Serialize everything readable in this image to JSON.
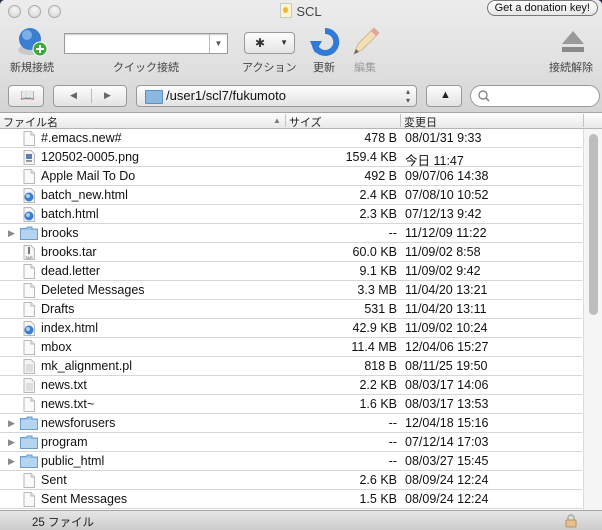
{
  "window": {
    "title": "SCL",
    "donation_button": "Get a donation key!"
  },
  "toolbar": {
    "new_connection": "新規接続",
    "quick_connect": "クイック接続",
    "quick_connect_value": "",
    "action": "アクション",
    "refresh": "更新",
    "edit": "編集",
    "disconnect": "接続解除"
  },
  "navbar": {
    "path": "/user1/scl7/fukumoto",
    "search_placeholder": ""
  },
  "columns": {
    "name": "ファイル名",
    "size": "サイズ",
    "modified": "変更日",
    "sort_indicator": "▲"
  },
  "files": [
    {
      "name": "#.emacs.new#",
      "size": "478 B",
      "date": "08/01/31 9:33",
      "type": "file"
    },
    {
      "name": "120502-0005.png",
      "size": "159.4 KB",
      "date": "今日 11:47",
      "type": "image"
    },
    {
      "name": "Apple Mail To Do",
      "size": "492 B",
      "date": "09/07/06 14:38",
      "type": "file"
    },
    {
      "name": "batch_new.html",
      "size": "2.4 KB",
      "date": "07/08/10 10:52",
      "type": "html"
    },
    {
      "name": "batch.html",
      "size": "2.3 KB",
      "date": "07/12/13 9:42",
      "type": "html"
    },
    {
      "name": "brooks",
      "size": "--",
      "date": "11/12/09 11:22",
      "type": "folder"
    },
    {
      "name": "brooks.tar",
      "size": "60.0 KB",
      "date": "11/09/02 8:58",
      "type": "archive"
    },
    {
      "name": "dead.letter",
      "size": "9.1 KB",
      "date": "11/09/02 9:42",
      "type": "file"
    },
    {
      "name": "Deleted Messages",
      "size": "3.3 MB",
      "date": "11/04/20 13:21",
      "type": "file"
    },
    {
      "name": "Drafts",
      "size": "531 B",
      "date": "11/04/20 13:11",
      "type": "file"
    },
    {
      "name": "index.html",
      "size": "42.9 KB",
      "date": "11/09/02 10:24",
      "type": "html"
    },
    {
      "name": "mbox",
      "size": "11.4 MB",
      "date": "12/04/06 15:27",
      "type": "file"
    },
    {
      "name": "mk_alignment.pl",
      "size": "818 B",
      "date": "08/11/25 19:50",
      "type": "text"
    },
    {
      "name": "news.txt",
      "size": "2.2 KB",
      "date": "08/03/17 14:06",
      "type": "text"
    },
    {
      "name": "news.txt~",
      "size": "1.6 KB",
      "date": "08/03/17 13:53",
      "type": "file"
    },
    {
      "name": "newsforusers",
      "size": "--",
      "date": "12/04/18 15:16",
      "type": "folder"
    },
    {
      "name": "program",
      "size": "--",
      "date": "07/12/14 17:03",
      "type": "folder"
    },
    {
      "name": "public_html",
      "size": "--",
      "date": "08/03/27 15:45",
      "type": "folder"
    },
    {
      "name": "Sent",
      "size": "2.6 KB",
      "date": "08/09/24 12:24",
      "type": "file"
    },
    {
      "name": "Sent Messages",
      "size": "1.5 KB",
      "date": "08/09/24 12:24",
      "type": "file"
    }
  ],
  "status": {
    "count": "25 ファイル"
  },
  "colors": {
    "accent_blue": "#3a7fd0",
    "folder": "#8ab8e0"
  }
}
